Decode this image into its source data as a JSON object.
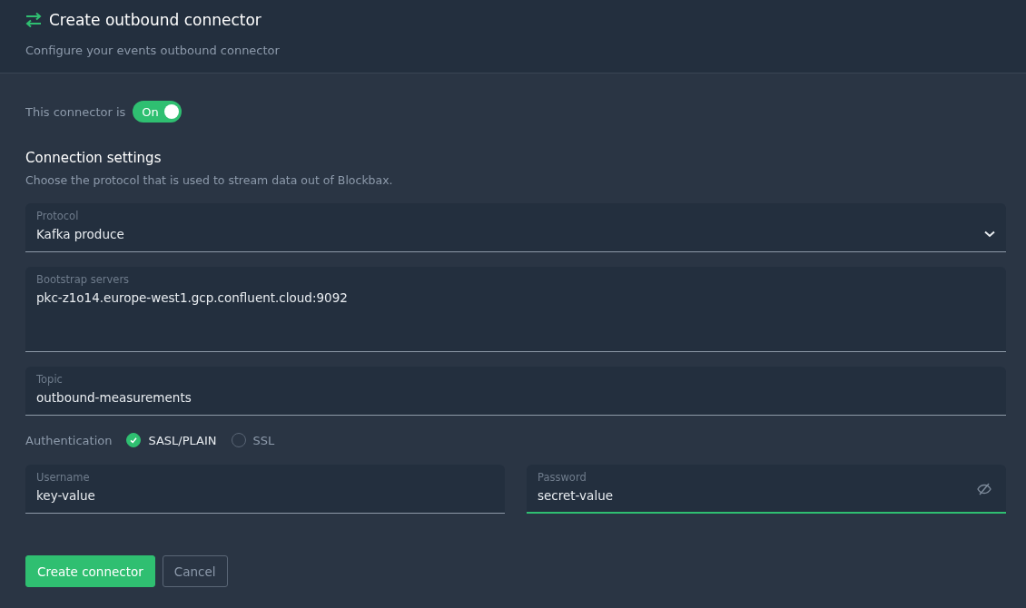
{
  "header": {
    "title": "Create outbound connector",
    "subtitle": "Configure your events outbound connector"
  },
  "status": {
    "label": "This connector is",
    "toggle": {
      "text": "On",
      "on": true
    }
  },
  "section": {
    "title": "Connection settings",
    "description": "Choose the protocol that is used to stream data out of Blockbax."
  },
  "protocol": {
    "label": "Protocol",
    "value": "Kafka produce",
    "focused": false
  },
  "bootstrap": {
    "label": "Bootstrap servers",
    "value": "pkc-z1o14.europe-west1.gcp.confluent.cloud:9092",
    "focused": false
  },
  "topic": {
    "label": "Topic",
    "value": "outbound-measurements",
    "focused": false
  },
  "authentication": {
    "label": "Authentication",
    "options": [
      {
        "label": "SASL/PLAIN",
        "selected": true
      },
      {
        "label": "SSL",
        "selected": false
      }
    ]
  },
  "username": {
    "label": "Username",
    "value": "key-value",
    "focused": false
  },
  "password": {
    "label": "Password",
    "value": "secret-value",
    "focused": true
  },
  "buttons": [
    {
      "label": "Create connector",
      "kind": "primary"
    },
    {
      "label": "Cancel",
      "kind": "secondary"
    }
  ]
}
